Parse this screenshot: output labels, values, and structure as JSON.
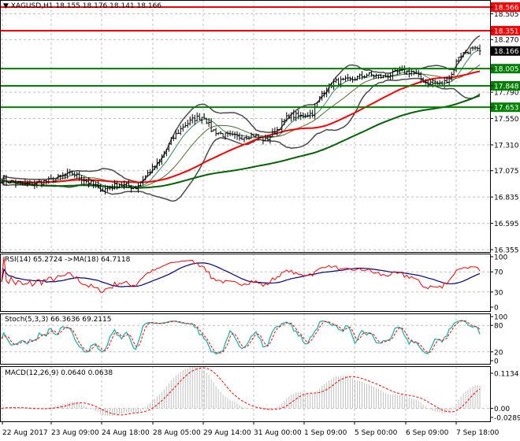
{
  "header": {
    "symbol": "XAGUSD,H1",
    "open": "18.155",
    "high": "18.176",
    "low": "18.141",
    "close": "18.166"
  },
  "colors": {
    "resistance": "#ff0000",
    "support": "#008000",
    "bars": "#000000",
    "grid": "#c0c0c0",
    "bollinger": "#4a4a4a",
    "ma_fast": "#ff0000",
    "ma_slow": "#006400",
    "rsi": "#ff0000",
    "rsi_ma": "#000080",
    "stoch_main": "#20b2aa",
    "stoch_signal": "#ff0000",
    "macd_hist": "#c0c0c0",
    "macd_signal": "#ff0000"
  },
  "chart_data": {
    "type": "candlestick",
    "price_axis": {
      "min": 16.355,
      "max": 18.566,
      "ticks": [
        "18.505",
        "18.270",
        "17.790",
        "17.550",
        "17.310",
        "17.075",
        "16.835",
        "16.595",
        "16.355"
      ]
    },
    "current_price": "18.166",
    "levels": [
      {
        "value": "18.566",
        "kind": "resistance"
      },
      {
        "value": "18.351",
        "kind": "resistance"
      },
      {
        "value": "18.005",
        "kind": "support"
      },
      {
        "value": "17.848",
        "kind": "support"
      },
      {
        "value": "17.653",
        "kind": "support"
      }
    ],
    "price_anchors": [
      [
        0,
        16.99
      ],
      [
        10,
        16.95
      ],
      [
        20,
        16.98
      ],
      [
        30,
        17.05
      ],
      [
        37,
        16.97
      ],
      [
        43,
        16.9
      ],
      [
        50,
        16.95
      ],
      [
        57,
        16.92
      ],
      [
        62,
        17.05
      ],
      [
        67,
        17.15
      ],
      [
        72,
        17.35
      ],
      [
        77,
        17.48
      ],
      [
        82,
        17.55
      ],
      [
        86,
        17.57
      ],
      [
        89,
        17.45
      ],
      [
        94,
        17.4
      ],
      [
        100,
        17.38
      ],
      [
        107,
        17.4
      ],
      [
        112,
        17.35
      ],
      [
        117,
        17.45
      ],
      [
        122,
        17.58
      ],
      [
        127,
        17.57
      ],
      [
        132,
        17.6
      ],
      [
        136,
        17.78
      ],
      [
        141,
        17.88
      ],
      [
        148,
        17.9
      ],
      [
        155,
        17.95
      ],
      [
        162,
        17.93
      ],
      [
        168,
        17.97
      ],
      [
        174,
        17.98
      ],
      [
        180,
        17.88
      ],
      [
        187,
        17.86
      ],
      [
        191,
        17.95
      ],
      [
        194,
        18.12
      ],
      [
        199,
        18.18
      ],
      [
        203,
        18.166
      ]
    ],
    "time_labels": [
      "22 Aug 2017",
      "23 Aug 09:00",
      "24 Aug 18:00",
      "28 Aug 05:00",
      "29 Aug 14:00",
      "31 Aug 00:00",
      "1 Sep 09:00",
      "5 Sep 00:00",
      "6 Sep 09:00",
      "7 Sep 18:00"
    ],
    "rsi": {
      "label": "RSI(14) 65.2724  ->MA(18) 64.7118",
      "levels": [
        "100",
        "70",
        "30",
        "0"
      ]
    },
    "stoch": {
      "label": "Stoch(5,3,3) 66.3636 69.2115",
      "levels": [
        "100",
        "80",
        "20",
        "0"
      ]
    },
    "macd": {
      "label": "MACD(12,26,9) 0.0640 0.0638",
      "levels": [
        "0.1134",
        "0.00",
        "-0.0289"
      ]
    }
  }
}
